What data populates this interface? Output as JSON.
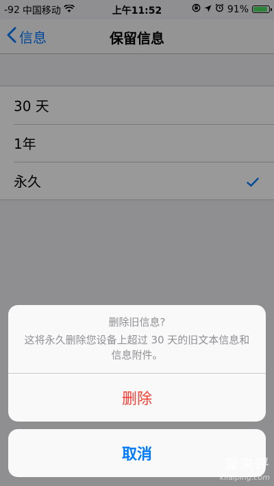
{
  "status_bar": {
    "signal": "-92",
    "carrier": "中国移动",
    "time": "上午11:52",
    "battery_percent": "91%",
    "battery_level": 0.91
  },
  "nav": {
    "back_label": "信息",
    "title": "保留信息"
  },
  "options": [
    {
      "label": "30 天",
      "selected": false
    },
    {
      "label": "1年",
      "selected": false
    },
    {
      "label": "永久",
      "selected": true
    }
  ],
  "action_sheet": {
    "title": "删除旧信息?",
    "message": "这将永久删除您设备上超过 30 天的旧文本信息和信息附件。",
    "delete_label": "删除",
    "cancel_label": "取消",
    "delete_color": "#ff3b30",
    "cancel_color": "#007aff"
  },
  "watermark": {
    "main": "爱来评",
    "sub": "kilaiping.com"
  },
  "colors": {
    "ios_blue": "#007aff",
    "ios_red": "#ff3b30",
    "battery_green": "#4cd964"
  }
}
